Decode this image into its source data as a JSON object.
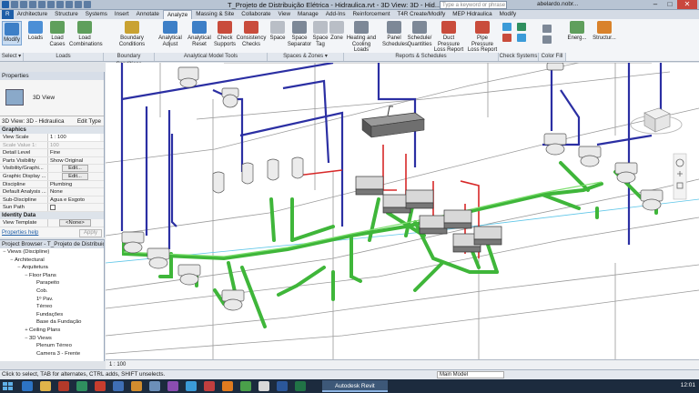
{
  "window": {
    "title": "T_Projeto de Distribuição Elétrica - Hidraulica.rvt - 3D View: 3D - Hid...",
    "search_placeholder": "Type a keyword or phrase",
    "user": "abelardo.nobr...",
    "minimize": "–",
    "maximize": "□",
    "close": "✕"
  },
  "tabs": [
    "R",
    "Architecture",
    "Structure",
    "Systems",
    "Insert",
    "Annotate",
    "Analyze",
    "Massing & Site",
    "Collaborate",
    "View",
    "Manage",
    "Add-Ins",
    "Reinforcement",
    "T4R Create/Modify",
    "MEP Hidraulica",
    "Modify"
  ],
  "active_tab": "Analyze",
  "ribbon": {
    "buttons": [
      {
        "label": "Modify",
        "color": "#3d7fc7"
      },
      {
        "label": "Loads",
        "color": "#4c8fd6"
      },
      {
        "label": "Load Cases",
        "color": "#5f9f5c"
      },
      {
        "label": "Load Combinations",
        "color": "#5f9f5c"
      },
      {
        "label": "Boundary Conditions",
        "color": "#c9a232"
      },
      {
        "label": "Analytical Adjust",
        "color": "#3d7fc7"
      },
      {
        "label": "Analytical Reset",
        "color": "#3d7fc7"
      },
      {
        "label": "Check Supports",
        "color": "#c94c3c"
      },
      {
        "label": "Consistency Checks",
        "color": "#c94c3c"
      },
      {
        "label": "Space",
        "color": "#b9bec6"
      },
      {
        "label": "Space Separator",
        "color": "#7d8897"
      },
      {
        "label": "Space Tag",
        "color": "#b9bec6"
      },
      {
        "label": "Zone",
        "color": "#b9bec6"
      },
      {
        "label": "Heating and Cooling Loads",
        "color": "#7d8897"
      },
      {
        "label": "Panel Schedules",
        "color": "#7d8897"
      },
      {
        "label": "Schedule/ Quantities",
        "color": "#7d8897"
      },
      {
        "label": "Duct Pressure Loss Report",
        "color": "#c94c3c"
      },
      {
        "label": "Pipe Pressure Loss Report",
        "color": "#c94c3c"
      },
      {
        "label": "Energ...",
        "color": "#5f9f5c"
      },
      {
        "label": "Structur...",
        "color": "#d9822b"
      }
    ],
    "panels": [
      "Select ▾",
      "Loads",
      "Boundary Conditions",
      "Analytical Model Tools",
      "Spaces & Zones ▾",
      "Reports & Schedules",
      "Check Systems",
      "Color Fill"
    ]
  },
  "properties": {
    "header": "Properties",
    "type_name": "3D View",
    "view_selector": "3D View: 3D - Hidraulica",
    "edit_type": "Edit Type",
    "graphics_label": "Graphics",
    "identity_label": "Identity Data",
    "graphics_rows": [
      {
        "key": "View Scale",
        "value": "1 : 100",
        "kind": "field",
        "dim": false
      },
      {
        "key": "Scale Value  1:",
        "value": "100",
        "kind": "text",
        "dim": true
      },
      {
        "key": "Detail Level",
        "value": "Fine",
        "kind": "text",
        "dim": false
      },
      {
        "key": "Parts Visibility",
        "value": "Show Original",
        "kind": "text",
        "dim": false
      },
      {
        "key": "Visibility/Graphi...",
        "value": "Edit...",
        "kind": "btn",
        "dim": false
      },
      {
        "key": "Graphic Display ...",
        "value": "Edit...",
        "kind": "btn",
        "dim": false
      },
      {
        "key": "Discipline",
        "value": "Plumbing",
        "kind": "text",
        "dim": false
      },
      {
        "key": "Default Analysis ...",
        "value": "None",
        "kind": "text",
        "dim": false
      },
      {
        "key": "Sub-Discipline",
        "value": "Agua e Esgoto",
        "kind": "text",
        "dim": false
      },
      {
        "key": "Sun Path",
        "value": "",
        "kind": "check",
        "dim": false
      }
    ],
    "identity_rows": [
      {
        "key": "View Template",
        "value": "<None>",
        "kind": "btn",
        "dim": false
      }
    ],
    "help_link": "Properties help",
    "apply": "Apply"
  },
  "browser": {
    "header": "Project Browser - T_Projeto de Distribuiç...",
    "nodes": [
      {
        "label": "Views (Discipline)",
        "depth": 0,
        "twisty": "−"
      },
      {
        "label": "Architectural",
        "depth": 1,
        "twisty": "−"
      },
      {
        "label": "Arquitetura",
        "depth": 2,
        "twisty": "−"
      },
      {
        "label": "Floor Plans",
        "depth": 3,
        "twisty": "−"
      },
      {
        "label": "Parapeito",
        "depth": 4,
        "twisty": ""
      },
      {
        "label": "Cob.",
        "depth": 4,
        "twisty": ""
      },
      {
        "label": "1º Pav.",
        "depth": 4,
        "twisty": ""
      },
      {
        "label": "Térreo",
        "depth": 4,
        "twisty": ""
      },
      {
        "label": "Fundações",
        "depth": 4,
        "twisty": ""
      },
      {
        "label": "Base da Fundação",
        "depth": 4,
        "twisty": ""
      },
      {
        "label": "Ceiling Plans",
        "depth": 3,
        "twisty": "+"
      },
      {
        "label": "3D Views",
        "depth": 3,
        "twisty": "−"
      },
      {
        "label": "Plenum Térreo",
        "depth": 4,
        "twisty": ""
      },
      {
        "label": "Camera 3 - Frente",
        "depth": 4,
        "twisty": ""
      }
    ]
  },
  "viewport": {
    "scale_label": "1 : 100"
  },
  "statusbar": {
    "message": "Click to select, TAB for alternates, CTRL adds, SHIFT unselects.",
    "model": "Main Model"
  },
  "taskbar": {
    "task_label": "Autodesk Revit 2014 ...",
    "clock": "12:01"
  },
  "colors": {
    "pipe_blue": "#2b2fa3",
    "pipe_green": "#3fb63a",
    "pipe_red": "#d72828",
    "accent": "#1f5fa8"
  }
}
